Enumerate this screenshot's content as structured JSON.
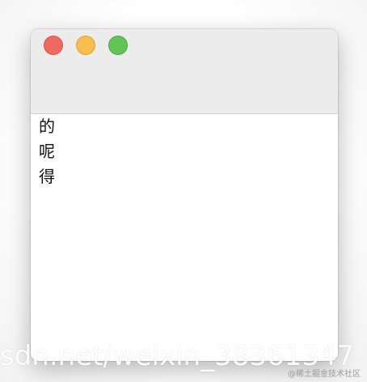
{
  "window": {
    "controls": {
      "close": {
        "icon": "close-dot",
        "color": "#ee6a5f"
      },
      "minimize": {
        "icon": "minimize-dot",
        "color": "#f5be4f"
      },
      "zoom": {
        "icon": "zoom-dot",
        "color": "#62c454"
      }
    },
    "content": {
      "lines": [
        "的",
        "呢",
        "得"
      ]
    }
  },
  "overlay": {
    "watermark": "sdn.net/weixin_38361347",
    "credit": "@稀土掘金技术社区"
  }
}
